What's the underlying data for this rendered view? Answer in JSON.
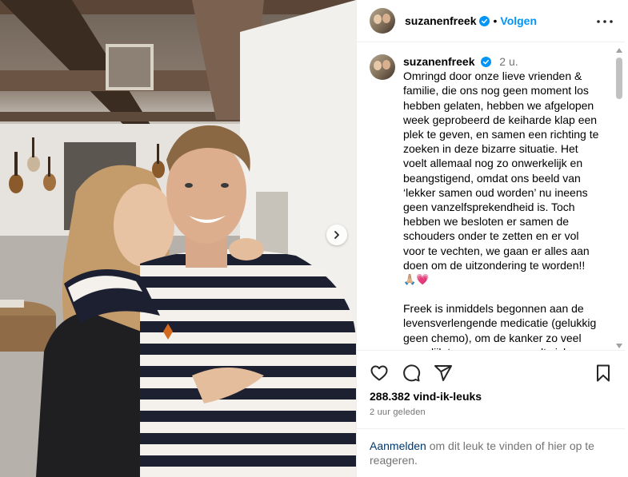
{
  "post": {
    "username": "suzanenfreek",
    "follow_label": "Volgen",
    "dot": "•",
    "time_ago": "2 u.",
    "caption_p1": "Omringd door onze lieve vrienden & familie, die ons nog geen moment los hebben gelaten, hebben we afgelopen week geprobeerd de keiharde klap een plek te geven, en samen een richting te zoeken in deze bizarre situatie. Het voelt allemaal nog zo onwerkelijk en beangstigend, omdat ons beeld van ‘lekker samen oud worden’ nu ineens geen vanzelfsprekendheid is. Toch hebben we besloten er samen de schouders onder te zetten en er vol voor te vechten, we gaan er alles aan doen om de uitzondering te worden!!",
    "caption_emojis": "🙏🏼💗",
    "caption_p2": "Freek is inmiddels begonnen aan de levensverlengende medicatie (gelukkig geen chemo), om de kanker zo veel mogelijk te remmen, en voelt zich",
    "likes": "288.382 vind-ik-leuks",
    "posted": "2 uur geleden",
    "login_link": "Aanmelden",
    "login_rest": " om dit leuk te vinden of hier op te reageren."
  },
  "icons": {
    "verified": "verified-badge-icon",
    "more": "more-options-icon",
    "like": "heart-icon",
    "comment": "comment-icon",
    "share": "share-icon",
    "save": "bookmark-icon",
    "next": "chevron-right-icon"
  },
  "colors": {
    "link_blue": "#0095f6",
    "login_blue": "#00376b",
    "muted": "#737373",
    "border": "#efefef"
  }
}
